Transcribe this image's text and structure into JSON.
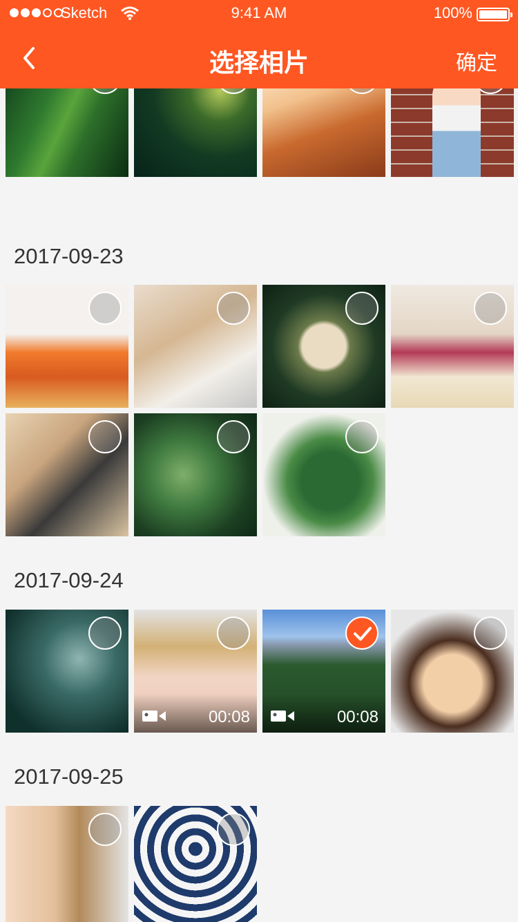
{
  "status_bar": {
    "carrier": "Sketch",
    "time": "9:41 AM",
    "battery": "100%"
  },
  "nav": {
    "title": "选择相片",
    "confirm_label": "确定",
    "back_icon": "chevron-left-icon"
  },
  "groups": [
    {
      "date": "",
      "photos": [
        {
          "selected": false
        },
        {
          "selected": false
        },
        {
          "selected": false
        },
        {
          "selected": false
        }
      ]
    },
    {
      "date": "2017-09-23",
      "photos": [
        {
          "selected": false
        },
        {
          "selected": false
        },
        {
          "selected": false
        },
        {
          "selected": false
        },
        {
          "selected": false
        },
        {
          "selected": false
        },
        {
          "selected": false
        }
      ]
    },
    {
      "date": "2017-09-24",
      "photos": [
        {
          "selected": false
        },
        {
          "selected": false,
          "video": true,
          "duration": "00:08"
        },
        {
          "selected": true,
          "video": true,
          "duration": "00:08"
        },
        {
          "selected": false
        }
      ]
    },
    {
      "date": "2017-09-25",
      "photos": [
        {
          "selected": false
        },
        {
          "selected": false
        }
      ]
    }
  ],
  "colors": {
    "accent": "#ff5722",
    "background": "#f4f4f4"
  }
}
